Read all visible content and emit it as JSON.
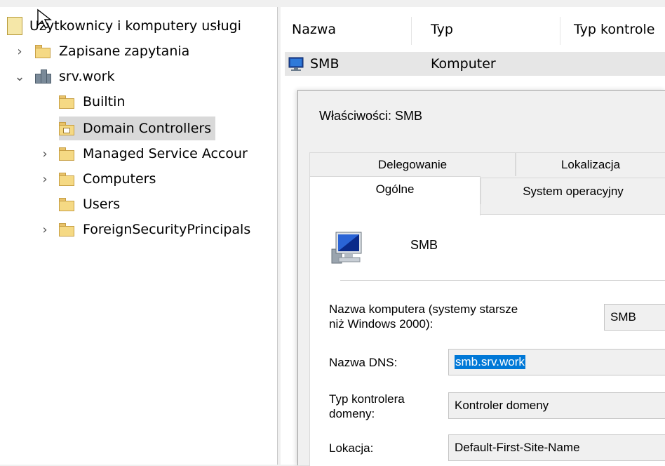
{
  "tree": {
    "root_label": "Użytkownicy i komputery usługi",
    "items": [
      {
        "label": "Zapisane zapytania",
        "expander": "›"
      },
      {
        "label": "srv.work",
        "expander": "⌄"
      },
      {
        "label": "Builtin",
        "expander": ""
      },
      {
        "label": "Domain Controllers",
        "expander": ""
      },
      {
        "label": "Managed Service Accour",
        "expander": "›"
      },
      {
        "label": "Computers",
        "expander": "›"
      },
      {
        "label": "Users",
        "expander": ""
      },
      {
        "label": "ForeignSecurityPrincipals",
        "expander": "›"
      }
    ]
  },
  "list": {
    "columns": [
      "Nazwa",
      "Typ",
      "Typ kontrole"
    ],
    "rows": [
      {
        "name": "SMB",
        "type": "Komputer"
      }
    ]
  },
  "dialog": {
    "title": "Właściwości: SMB",
    "tabs_back": [
      "Delegowanie",
      "Lokalizacja"
    ],
    "tabs_front": [
      "Ogólne",
      "System operacyjny"
    ],
    "object_name": "SMB",
    "fields": {
      "netbios_label_1": "Nazwa komputera (systemy starsze",
      "netbios_label_2": "niż Windows 2000):",
      "netbios_value": "SMB",
      "dns_label": "Nazwa DNS:",
      "dns_value": "smb.srv.work",
      "dc_type_label_1": "Typ kontrolera",
      "dc_type_label_2": "domeny:",
      "dc_type_value": "Kontroler domeny",
      "site_label": "Lokacja:",
      "site_value": "Default-First-Site-Name"
    }
  },
  "colors": {
    "selection": "#d9d9d9",
    "highlight": "#0078d7",
    "folder": "#f5d984"
  }
}
